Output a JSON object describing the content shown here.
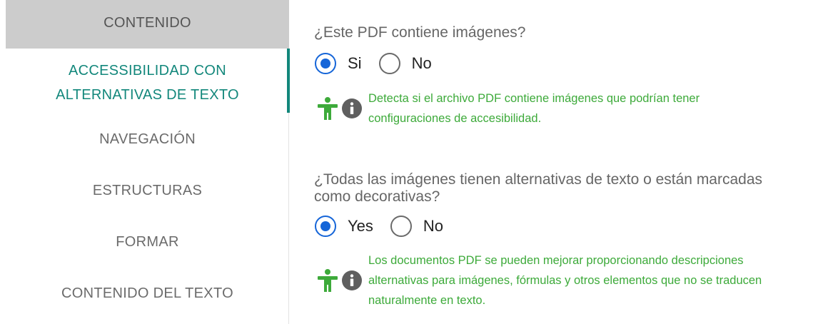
{
  "sidebar": {
    "items": [
      {
        "label": "CONTENIDO"
      },
      {
        "label_line1": "ACCESSIBILIDAD CON",
        "label_line2": "ALTERNATIVAS DE TEXTO"
      },
      {
        "label": "NAVEGACIÓN"
      },
      {
        "label": "ESTRUCTURAS"
      },
      {
        "label": "FORMAR"
      },
      {
        "label": "CONTENIDO DEL TEXTO"
      }
    ]
  },
  "questions": [
    {
      "text": "¿Este PDF contiene imágenes?",
      "options": [
        {
          "label": "Si",
          "checked": true
        },
        {
          "label": "No",
          "checked": false
        }
      ],
      "hint": "Detecta si el archivo PDF contiene imágenes que podrían tener configuraciones de accesibilidad."
    },
    {
      "text": "¿Todas las imágenes tienen alternativas de texto o están marcadas como decorativas?",
      "options": [
        {
          "label": "Yes",
          "checked": true
        },
        {
          "label": "No",
          "checked": false
        }
      ],
      "hint": "Los documentos PDF se pueden mejorar proporcionando descripciones alternativas para imágenes, fórmulas y otros elementos que no se traducen naturalmente en texto."
    }
  ],
  "colors": {
    "accent_teal": "#12877b",
    "radio_blue": "#1565d8",
    "hint_green": "#3daa3a",
    "selected_bg": "#cccccc"
  },
  "icons": {
    "accessibility": "accessibility-icon",
    "info": "info-icon"
  }
}
